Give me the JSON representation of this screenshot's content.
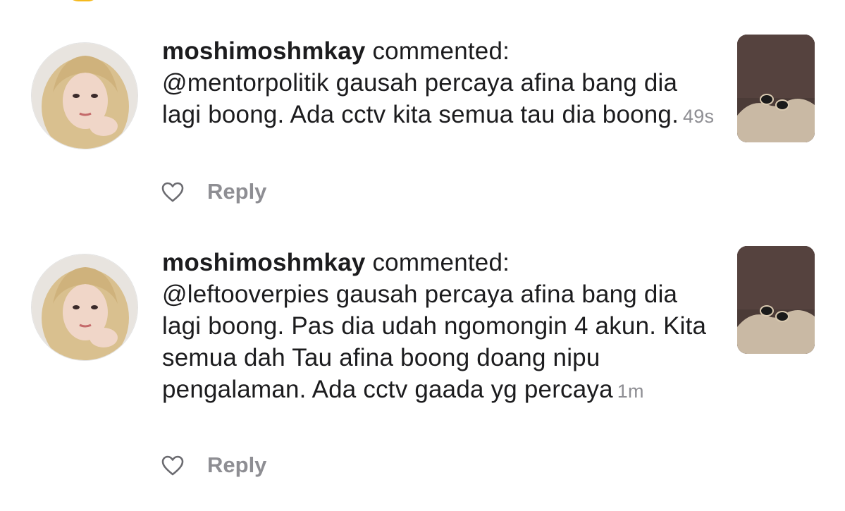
{
  "notifications": [
    {
      "username": "moshimoshmkay",
      "action": "commented:",
      "comment": "@mentorpolitik gausah percaya afina bang dia lagi boong. Ada cctv kita semua tau dia boong.",
      "timestamp": "49s",
      "reply_label": "Reply",
      "like_icon": "heart-outline-icon"
    },
    {
      "username": "moshimoshmkay",
      "action": "commented:",
      "comment": "@leftooverpies gausah percaya afina bang dia lagi boong. Pas dia udah ngomongin 4 akun. Kita semua dah Tau afina boong doang nipu pengalaman. Ada cctv gaada yg percaya",
      "timestamp": "1m",
      "reply_label": "Reply",
      "like_icon": "heart-outline-icon"
    }
  ],
  "colors": {
    "text_primary": "#1c1c1e",
    "text_secondary": "#8e8e93",
    "background": "#ffffff"
  }
}
